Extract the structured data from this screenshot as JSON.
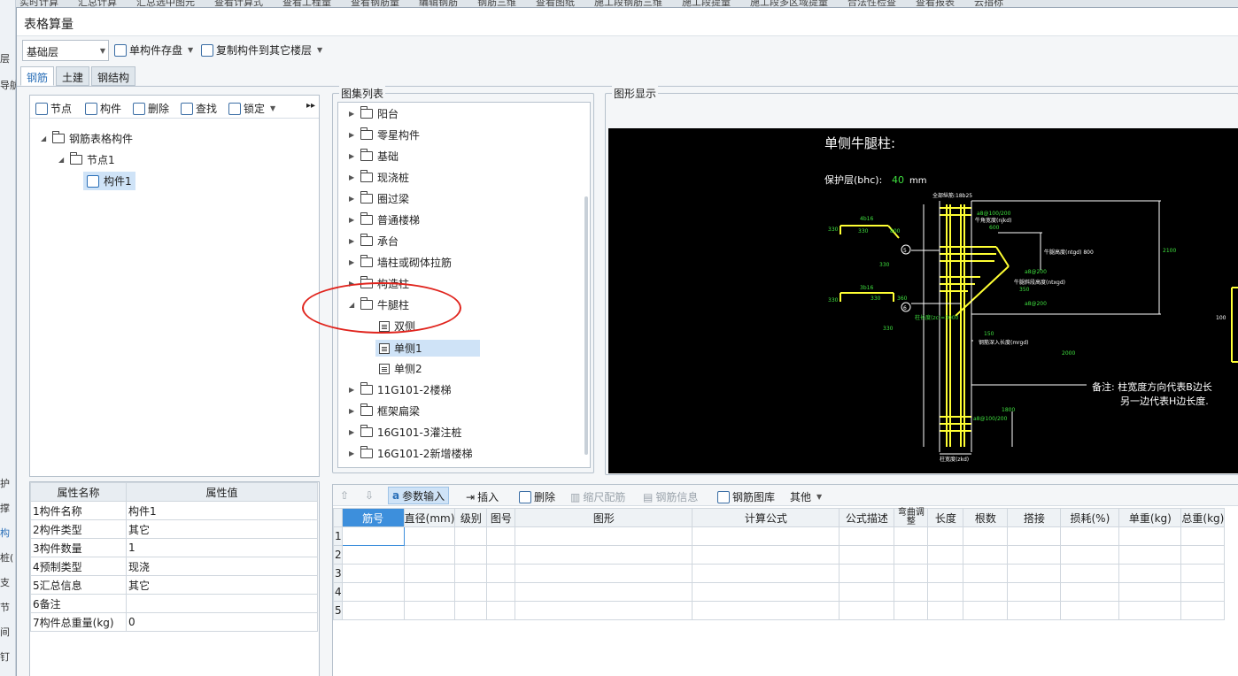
{
  "background": {
    "top_strip": [
      "实时计算",
      "汇总计算",
      "汇总选中图元",
      "查看计算式",
      "查看工程量",
      "查看钢筋量",
      "编辑钢筋",
      "钢筋三维",
      "查看图纸",
      "施工段钢筋三维",
      "施工段提量",
      "施工段多区域提量",
      "合法性检查",
      "查看报表",
      "云指标"
    ],
    "left_strip": [
      "层",
      "导航",
      "护",
      "撑",
      "构",
      "桩(",
      "支",
      "节",
      "间",
      "钉"
    ]
  },
  "window": {
    "title": "表格算量"
  },
  "toolbar": {
    "floor_select": "基础层",
    "save_component": "单构件存盘",
    "copy_component": "复制构件到其它楼层"
  },
  "tabs": [
    "钢筋",
    "土建",
    "钢结构"
  ],
  "left_toolbar": {
    "node": "节点",
    "component": "构件",
    "delete": "删除",
    "find": "查找",
    "lock": "锁定"
  },
  "left_tree": {
    "root": "钢筋表格构件",
    "node": "节点1",
    "component": "构件1"
  },
  "properties": {
    "headers": [
      "属性名称",
      "属性值"
    ],
    "rows": [
      {
        "num": "1",
        "name": "构件名称",
        "value": "构件1"
      },
      {
        "num": "2",
        "name": "构件类型",
        "value": "其它"
      },
      {
        "num": "3",
        "name": "构件数量",
        "value": "1"
      },
      {
        "num": "4",
        "name": "预制类型",
        "value": "现浇"
      },
      {
        "num": "5",
        "name": "汇总信息",
        "value": "其它"
      },
      {
        "num": "6",
        "name": "备注",
        "value": ""
      },
      {
        "num": "7",
        "name": "构件总重量(kg)",
        "value": "0"
      }
    ]
  },
  "atlas": {
    "title": "图集列表",
    "items": [
      "阳台",
      "零星构件",
      "基础",
      "现浇桩",
      "圈过梁",
      "普通楼梯",
      "承台",
      "墙柱或砌体拉筋",
      "构造柱",
      "牛腿柱"
    ],
    "children": [
      "双侧",
      "单侧1",
      "单侧2"
    ],
    "items_after": [
      "11G101-2楼梯",
      "框架扁梁",
      "16G101-3灌注桩",
      "16G101-2新增楼梯"
    ]
  },
  "graphic": {
    "title": "图形显示",
    "drawing_title": "单侧牛腿柱:",
    "cover_label": "保护层(bhc):",
    "cover_value": "40",
    "cover_unit": "mm",
    "note_line1": "备注: 柱宽度方向代表B边长",
    "note_line2": "另一边代表H边长度.",
    "small_labels": {
      "top_rebar": "全部纵筋:18b25",
      "stirrup_top": "a8@100/200",
      "corbel_width": "牛角宽度(njkd)",
      "corbel_w_val": "600",
      "corbel_height": "牛腿高度(ntgd) 800",
      "slope_height": "牛腿斜段高度(ntxgd)",
      "slope_val": "350",
      "stirrup_mid1": "a8@200",
      "stirrup_mid2": "a8@200",
      "anchor": "钢筋深入长度(mrgd)",
      "anchor_val": "150",
      "bar4": "4b16",
      "bar3": "3b16",
      "v330a": "330",
      "v330b": "330",
      "v330c": "330",
      "v330d": "330",
      "v330e": "330",
      "v330f": "330",
      "v800": "800",
      "v360": "360",
      "v2100": "2100",
      "v2000": "2000",
      "v1800": "1800",
      "col_height": "柱长度(zc)=3000",
      "stirrup_bot": "a8@100/200",
      "col_width": "柱宽度(zkd)",
      "mark5": "5",
      "mark6": "6",
      "v100": "100"
    }
  },
  "bottom_toolbar": {
    "param_input": "参数输入",
    "insert": "插入",
    "delete": "删除",
    "scale": "缩尺配筋",
    "rebar_info": "钢筋信息",
    "rebar_lib": "钢筋图库",
    "other": "其他"
  },
  "grid": {
    "headers": [
      "筋号",
      "直径(mm)",
      "级别",
      "图号",
      "图形",
      "计算公式",
      "公式描述",
      "弯曲调整",
      "长度",
      "根数",
      "搭接",
      "损耗(%)",
      "单重(kg)",
      "总重(kg)"
    ],
    "row_numbers": [
      "1",
      "2",
      "3",
      "4",
      "5"
    ]
  }
}
